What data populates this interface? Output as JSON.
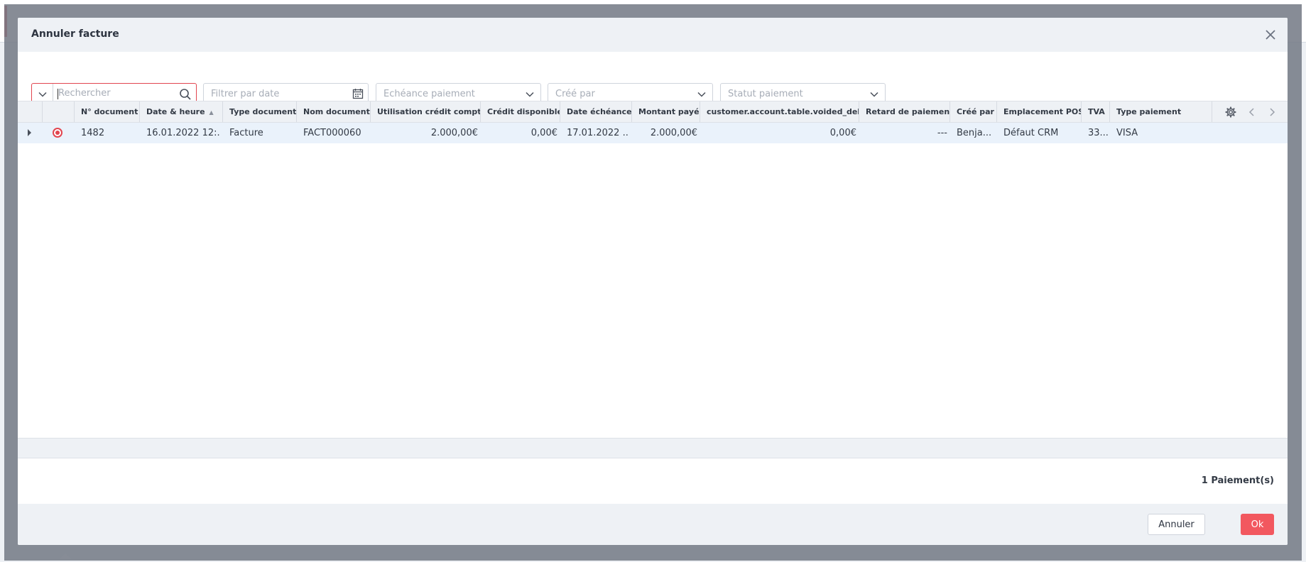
{
  "dialog": {
    "title": "Annuler facture",
    "close_icon": "close-icon"
  },
  "filters": {
    "search_placeholder": "Rechercher",
    "date_placeholder": "Filtrer par date",
    "due_placeholder": "Echéance paiement",
    "created_by_placeholder": "Créé par",
    "status_placeholder": "Statut paiement"
  },
  "table": {
    "columns": [
      "N° document",
      "Date & heure",
      "Type document",
      "Nom document",
      "Utilisation crédit compte",
      "Crédit disponible",
      "Date échéance",
      "Montant payé",
      "customer.account.table.voided_debit",
      "Retard de paiement",
      "Créé par",
      "Emplacement POS",
      "TVA",
      "Type paiement"
    ],
    "rows": [
      {
        "doc_no": "1482",
        "datetime": "16.01.2022 12:...",
        "doc_type": "Facture",
        "doc_name": "FACT000060",
        "credit_used": "2.000,00€",
        "credit_available": "0,00€",
        "due_date": "17.01.2022 ...",
        "amount_paid": "2.000,00€",
        "voided_debit": "0,00€",
        "late_payment": "---",
        "created_by": "Benja...",
        "pos_location": "Défaut CRM",
        "vat": "33...",
        "payment_type": "VISA",
        "selected": true
      }
    ]
  },
  "summary": "1 Paiement(s)",
  "buttons": {
    "cancel": "Annuler",
    "ok": "Ok"
  },
  "colors": {
    "accent": "#f2585f",
    "selected_row": "#eaf2fb",
    "header_bg": "#eef1f5"
  }
}
